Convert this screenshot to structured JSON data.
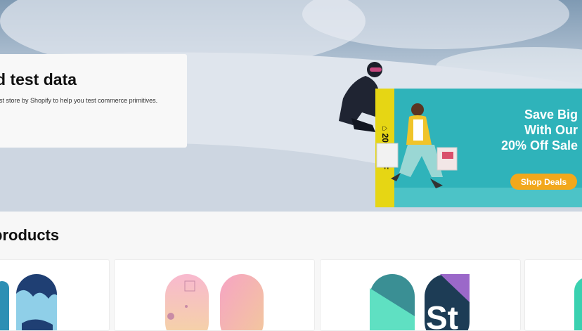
{
  "hero": {
    "title": "d test data",
    "subtitle": "est store by Shopify to help you test commerce primitives."
  },
  "promo": {
    "strip_text": "20% OFF",
    "headline": [
      "Save Big",
      "With Our",
      "20% Off Sale"
    ],
    "button_label": "Shop Deals",
    "colors": {
      "background": "#2fb3ba",
      "strip": "#e6d614",
      "button": "#f2a81c"
    }
  },
  "products_section": {
    "title": "products"
  },
  "product_cards": [
    {
      "image": "blue-drip-snowboards"
    },
    {
      "image": "pink-pastel-snowboards"
    },
    {
      "image": "teal-purple-snowboards"
    },
    {
      "image": "teal-snowboard-partial"
    }
  ]
}
